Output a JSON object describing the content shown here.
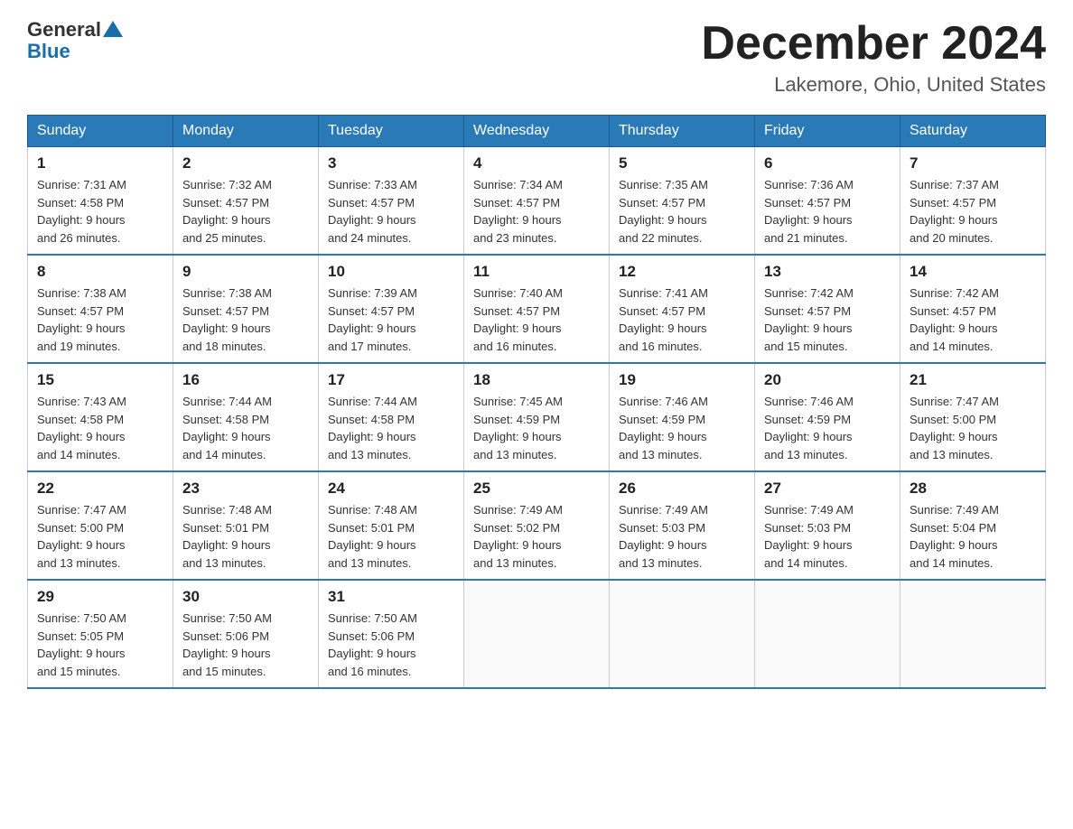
{
  "header": {
    "logo_general": "General",
    "logo_blue": "Blue",
    "month_title": "December 2024",
    "location": "Lakemore, Ohio, United States"
  },
  "days_of_week": [
    "Sunday",
    "Monday",
    "Tuesday",
    "Wednesday",
    "Thursday",
    "Friday",
    "Saturday"
  ],
  "weeks": [
    [
      {
        "day": "1",
        "sunrise": "7:31 AM",
        "sunset": "4:58 PM",
        "daylight": "9 hours and 26 minutes."
      },
      {
        "day": "2",
        "sunrise": "7:32 AM",
        "sunset": "4:57 PM",
        "daylight": "9 hours and 25 minutes."
      },
      {
        "day": "3",
        "sunrise": "7:33 AM",
        "sunset": "4:57 PM",
        "daylight": "9 hours and 24 minutes."
      },
      {
        "day": "4",
        "sunrise": "7:34 AM",
        "sunset": "4:57 PM",
        "daylight": "9 hours and 23 minutes."
      },
      {
        "day": "5",
        "sunrise": "7:35 AM",
        "sunset": "4:57 PM",
        "daylight": "9 hours and 22 minutes."
      },
      {
        "day": "6",
        "sunrise": "7:36 AM",
        "sunset": "4:57 PM",
        "daylight": "9 hours and 21 minutes."
      },
      {
        "day": "7",
        "sunrise": "7:37 AM",
        "sunset": "4:57 PM",
        "daylight": "9 hours and 20 minutes."
      }
    ],
    [
      {
        "day": "8",
        "sunrise": "7:38 AM",
        "sunset": "4:57 PM",
        "daylight": "9 hours and 19 minutes."
      },
      {
        "day": "9",
        "sunrise": "7:38 AM",
        "sunset": "4:57 PM",
        "daylight": "9 hours and 18 minutes."
      },
      {
        "day": "10",
        "sunrise": "7:39 AM",
        "sunset": "4:57 PM",
        "daylight": "9 hours and 17 minutes."
      },
      {
        "day": "11",
        "sunrise": "7:40 AM",
        "sunset": "4:57 PM",
        "daylight": "9 hours and 16 minutes."
      },
      {
        "day": "12",
        "sunrise": "7:41 AM",
        "sunset": "4:57 PM",
        "daylight": "9 hours and 16 minutes."
      },
      {
        "day": "13",
        "sunrise": "7:42 AM",
        "sunset": "4:57 PM",
        "daylight": "9 hours and 15 minutes."
      },
      {
        "day": "14",
        "sunrise": "7:42 AM",
        "sunset": "4:57 PM",
        "daylight": "9 hours and 14 minutes."
      }
    ],
    [
      {
        "day": "15",
        "sunrise": "7:43 AM",
        "sunset": "4:58 PM",
        "daylight": "9 hours and 14 minutes."
      },
      {
        "day": "16",
        "sunrise": "7:44 AM",
        "sunset": "4:58 PM",
        "daylight": "9 hours and 14 minutes."
      },
      {
        "day": "17",
        "sunrise": "7:44 AM",
        "sunset": "4:58 PM",
        "daylight": "9 hours and 13 minutes."
      },
      {
        "day": "18",
        "sunrise": "7:45 AM",
        "sunset": "4:59 PM",
        "daylight": "9 hours and 13 minutes."
      },
      {
        "day": "19",
        "sunrise": "7:46 AM",
        "sunset": "4:59 PM",
        "daylight": "9 hours and 13 minutes."
      },
      {
        "day": "20",
        "sunrise": "7:46 AM",
        "sunset": "4:59 PM",
        "daylight": "9 hours and 13 minutes."
      },
      {
        "day": "21",
        "sunrise": "7:47 AM",
        "sunset": "5:00 PM",
        "daylight": "9 hours and 13 minutes."
      }
    ],
    [
      {
        "day": "22",
        "sunrise": "7:47 AM",
        "sunset": "5:00 PM",
        "daylight": "9 hours and 13 minutes."
      },
      {
        "day": "23",
        "sunrise": "7:48 AM",
        "sunset": "5:01 PM",
        "daylight": "9 hours and 13 minutes."
      },
      {
        "day": "24",
        "sunrise": "7:48 AM",
        "sunset": "5:01 PM",
        "daylight": "9 hours and 13 minutes."
      },
      {
        "day": "25",
        "sunrise": "7:49 AM",
        "sunset": "5:02 PM",
        "daylight": "9 hours and 13 minutes."
      },
      {
        "day": "26",
        "sunrise": "7:49 AM",
        "sunset": "5:03 PM",
        "daylight": "9 hours and 13 minutes."
      },
      {
        "day": "27",
        "sunrise": "7:49 AM",
        "sunset": "5:03 PM",
        "daylight": "9 hours and 14 minutes."
      },
      {
        "day": "28",
        "sunrise": "7:49 AM",
        "sunset": "5:04 PM",
        "daylight": "9 hours and 14 minutes."
      }
    ],
    [
      {
        "day": "29",
        "sunrise": "7:50 AM",
        "sunset": "5:05 PM",
        "daylight": "9 hours and 15 minutes."
      },
      {
        "day": "30",
        "sunrise": "7:50 AM",
        "sunset": "5:06 PM",
        "daylight": "9 hours and 15 minutes."
      },
      {
        "day": "31",
        "sunrise": "7:50 AM",
        "sunset": "5:06 PM",
        "daylight": "9 hours and 16 minutes."
      },
      null,
      null,
      null,
      null
    ]
  ],
  "labels": {
    "sunrise": "Sunrise:",
    "sunset": "Sunset:",
    "daylight": "Daylight:"
  }
}
